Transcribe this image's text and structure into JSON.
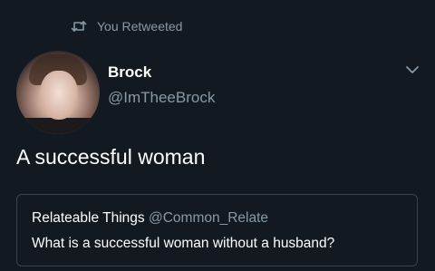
{
  "retweet": {
    "icon": "retweet-icon",
    "label": "You Retweeted"
  },
  "author": {
    "name": "Brock",
    "handle": "@ImTheeBrock"
  },
  "tweet": {
    "text": "A successful woman",
    "menu_icon": "chevron-down-icon"
  },
  "quoted_tweet": {
    "author_name": "Relateable Things",
    "author_handle": "@Common_Relate",
    "text": "What is a successful woman without a husband?"
  },
  "colors": {
    "background": "#131921",
    "primary_text": "#ffffff",
    "secondary_text": "#8899a6",
    "border": "#38444d"
  }
}
